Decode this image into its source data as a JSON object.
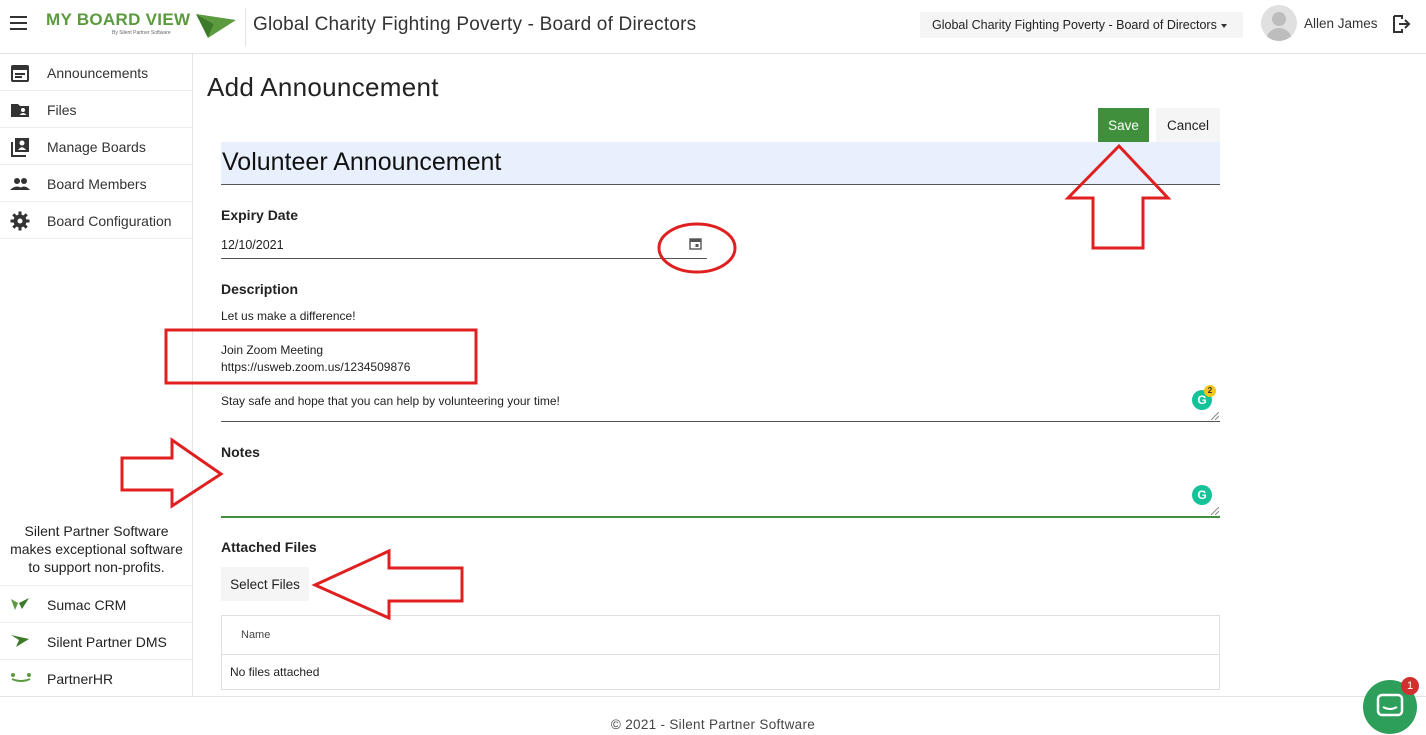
{
  "header": {
    "logo_text": "MY BOARD VIEW",
    "logo_sub": "By Silent Partner Software",
    "board_title": "Global Charity Fighting Poverty - Board of Directors",
    "board_select": "Global Charity Fighting Poverty - Board of Directors",
    "user_name": "Allen James"
  },
  "sidebar": {
    "items": [
      {
        "label": "Announcements",
        "icon": "calendar-icon"
      },
      {
        "label": "Files",
        "icon": "folder-user-icon"
      },
      {
        "label": "Manage Boards",
        "icon": "contacts-book-icon"
      },
      {
        "label": "Board Members",
        "icon": "people-icon"
      },
      {
        "label": "Board Configuration",
        "icon": "gear-icon"
      }
    ],
    "promo": [
      "Silent Partner Software",
      "makes exceptional software",
      "to support non-profits."
    ],
    "products": [
      {
        "label": "Sumac CRM",
        "icon": "sumac-icon"
      },
      {
        "label": "Silent Partner DMS",
        "icon": "silent-partner-icon"
      },
      {
        "label": "PartnerHR",
        "icon": "partnerhr-icon"
      }
    ]
  },
  "main": {
    "page_title": "Add Announcement",
    "save_label": "Save",
    "cancel_label": "Cancel",
    "announcement_title": "Volunteer Announcement",
    "expiry_label": "Expiry Date",
    "expiry_value": "12/10/2021",
    "description_label": "Description",
    "description_lines": [
      "Let us make a difference!",
      "Join Zoom Meeting",
      "https://usweb.zoom.us/1234509876",
      "Stay safe and hope that you can help by volunteering your time!"
    ],
    "grammarly_count": "2",
    "notes_label": "Notes",
    "attached_label": "Attached Files",
    "select_files_label": "Select Files",
    "files_column": "Name",
    "files_empty": "No files attached"
  },
  "footer": {
    "copyright": "© 2021 - Silent Partner Software",
    "chat_badge": "1"
  },
  "colors": {
    "accent_green": "#3f8f3c",
    "title_bg": "#e8f0fe",
    "annotation_red": "#e02020"
  }
}
